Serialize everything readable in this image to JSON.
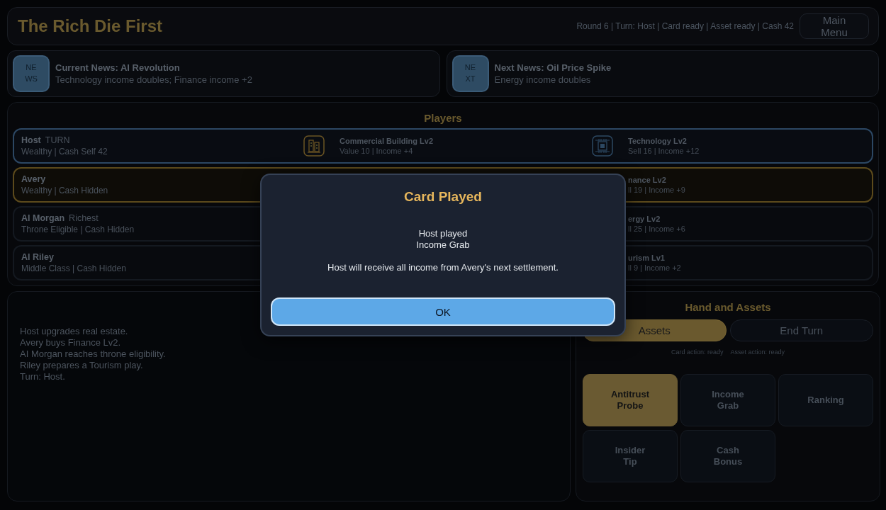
{
  "header": {
    "title": "The Rich Die First",
    "status": "Round 6 | Turn: Host | Card ready | Asset ready | Cash 42",
    "menu_button": "Main Menu"
  },
  "news": [
    {
      "badge": "NEWS",
      "title": "Current News: AI Revolution",
      "text": "Technology income doubles; Finance income +2"
    },
    {
      "badge": "NEXT",
      "title": "Next News: Oil Price Spike",
      "text": "Energy income doubles"
    }
  ],
  "players": {
    "title": "Players",
    "rows": [
      {
        "name": "Host",
        "tag": "TURN",
        "detail": "Wealthy | Cash Self 42",
        "active_turn": true,
        "selected": false,
        "first_asset": {
          "kind": "building",
          "name": "Commercial Building Lv2",
          "detail": "Value 10 | Income +4"
        },
        "second_asset": {
          "kind": "chip",
          "name": "Technology Lv2",
          "detail": "Sell 16 | Income +12"
        }
      },
      {
        "name": "Avery",
        "detail": "Wealthy | Cash Hidden",
        "active_turn": false,
        "selected": true,
        "second_asset": {
          "name": "nance Lv2",
          "detail": "ll 19 | Income +9"
        }
      },
      {
        "name": "AI Morgan",
        "tag": "Richest",
        "detail": "Throne Eligible | Cash Hidden",
        "active_turn": false,
        "selected": false,
        "second_asset": {
          "name": "ergy Lv2",
          "detail": "ll 25 | Income +6"
        }
      },
      {
        "name": "AI Riley",
        "detail": "Middle Class | Cash Hidden",
        "active_turn": false,
        "selected": false,
        "second_asset": {
          "name": "urism Lv1",
          "detail": "ll 9 | Income +2"
        }
      }
    ]
  },
  "log": {
    "lines": [
      "Host upgrades real estate.",
      "Avery buys Finance Lv2.",
      "AI Morgan reaches throne eligibility.",
      "Riley prepares a Tourism play.",
      "Turn: Host."
    ]
  },
  "hand": {
    "title": "Hand and Assets",
    "buttons": [
      {
        "label": "Assets",
        "selected": true
      },
      {
        "label": "End Turn",
        "selected": false
      }
    ],
    "status": [
      "Card action: ready",
      "Asset action: ready"
    ],
    "cards": [
      {
        "label": "Antitrust Probe",
        "selected": true
      },
      {
        "label": "Income Grab",
        "selected": false
      },
      {
        "label": "Ranking",
        "selected": false
      },
      {
        "label": "Insider Tip",
        "selected": false
      },
      {
        "label": "Cash Bonus",
        "selected": false
      }
    ]
  },
  "dialog": {
    "title": "Card Played",
    "lines": [
      "Host played",
      "Income Grab"
    ],
    "message": "Host will receive all income from Avery's next settlement.",
    "button": "OK"
  }
}
